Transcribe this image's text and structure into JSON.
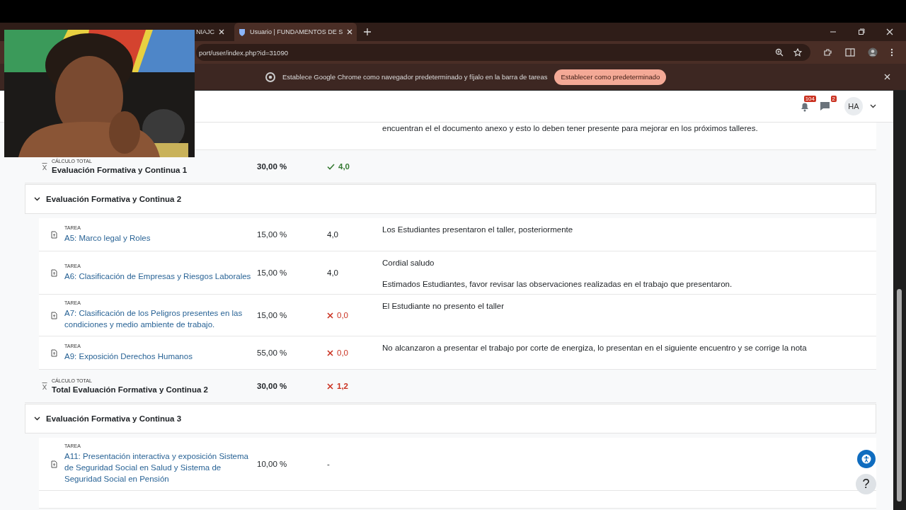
{
  "browser": {
    "tabs": [
      {
        "title": "NIAJC",
        "selected": false
      },
      {
        "title": "Usuario | FUNDAMENTOS DE S",
        "selected": true
      }
    ],
    "address": "port/user/index.php?id=31090"
  },
  "infobar": {
    "message": "Establece Google Chrome como navegador predeterminado y fíjalo en la barra de tareas",
    "button": "Establecer como predeterminado"
  },
  "header": {
    "notifications": "104",
    "messages": "2",
    "avatar": "HA"
  },
  "rows": [
    {
      "kind": "feedback",
      "feedback": [
        "encuentran el el documento anexo y esto lo deben tener presente para mejorar en los próximos talleres."
      ]
    },
    {
      "kind": "total",
      "label": "CÁLCULO TOTAL",
      "name": "Evaluación Formativa y Continua 1",
      "weight": "30,00 %",
      "grade": "4,0",
      "passed": true,
      "failed": false
    },
    {
      "kind": "category",
      "name": "Evaluación Formativa y Continua 2",
      "expanded": true
    },
    {
      "kind": "item",
      "label": "TAREA",
      "name": "A5: Marco legal y Roles",
      "weight": "15,00 %",
      "grade": "4,0",
      "passed": false,
      "failed": false,
      "feedback": [
        "Los Estudiantes presentaron el taller, posteriormente"
      ]
    },
    {
      "kind": "item",
      "label": "TAREA",
      "name": "A6: Clasificación de Empresas y Riesgos Laborales",
      "weight": "15,00 %",
      "grade": "4,0",
      "passed": false,
      "failed": false,
      "feedback": [
        "Cordial saludo",
        "Estimados Estudiantes, favor revisar las observaciones realizadas en el trabajo que presentaron."
      ]
    },
    {
      "kind": "item",
      "label": "TAREA",
      "name": "A7: Clasificación de los Peligros presentes en las condiciones y medio ambiente de trabajo.",
      "weight": "15,00 %",
      "grade": "0,0",
      "passed": false,
      "failed": true,
      "feedback": [
        "El Estudiante no presento el taller"
      ]
    },
    {
      "kind": "item",
      "label": "TAREA",
      "name": "A9: Exposición Derechos Humanos",
      "weight": "55,00 %",
      "grade": "0,0",
      "passed": false,
      "failed": true,
      "feedback": [
        "No alcanzaron a presentar el trabajo por corte de energiza, lo presentan en el siguiente encuentro y se corrige la nota"
      ]
    },
    {
      "kind": "total",
      "label": "CÁLCULO TOTAL",
      "name": "Total Evaluación Formativa y Continua 2",
      "weight": "30,00 %",
      "grade": "1,2",
      "passed": false,
      "failed": true
    },
    {
      "kind": "category",
      "name": "Evaluación Formativa y Continua 3",
      "expanded": true
    },
    {
      "kind": "item",
      "label": "TAREA",
      "name": "A11: Presentación interactiva y exposición Sistema de Seguridad Social en Salud y Sistema de Seguridad Social en Pensión",
      "weight": "10,00 %",
      "grade": "-",
      "passed": false,
      "failed": false
    },
    {
      "kind": "stub"
    }
  ],
  "help": {
    "label": "?"
  }
}
